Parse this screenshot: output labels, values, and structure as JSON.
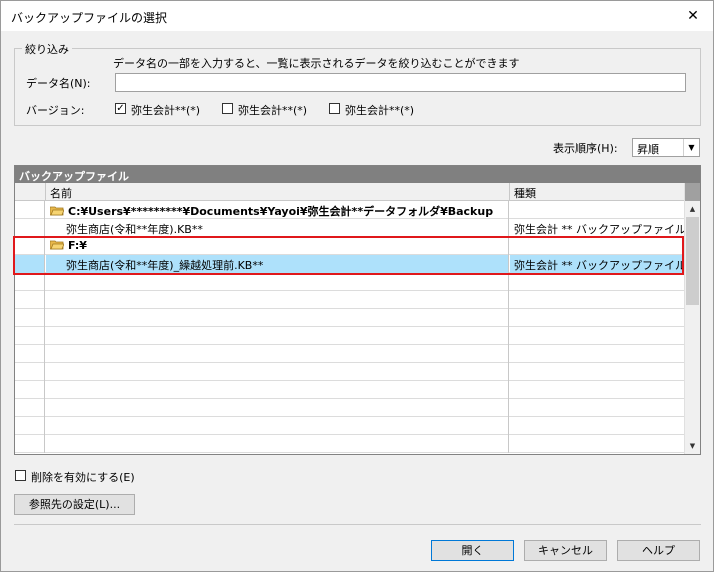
{
  "window": {
    "title": "バックアップファイルの選択",
    "close_label": "✕"
  },
  "filter": {
    "group_label": "絞り込み",
    "hint": "データ名の一部を入力すると、一覧に表示されるデータを絞り込むことができます",
    "dataname_label": "データ名(N):",
    "dataname_value": "",
    "version_label": "バージョン:",
    "versions": [
      {
        "label": "弥生会計**(*)",
        "checked": true
      },
      {
        "label": "弥生会計**(*)",
        "checked": false
      },
      {
        "label": "弥生会計**(*)",
        "checked": false
      }
    ]
  },
  "sort": {
    "label": "表示順序(H):",
    "value": "昇順"
  },
  "grid": {
    "caption": "バックアップファイル",
    "columns": [
      "名前",
      "種類"
    ],
    "rows": [
      {
        "type": "folder",
        "name": "C:¥Users¥*********¥Documents¥Yayoi¥弥生会計**データフォルダ¥Backup",
        "kind": ""
      },
      {
        "type": "file",
        "name": "弥生商店(令和**年度).KB**",
        "kind": "弥生会計 ** バックアップファイル"
      },
      {
        "type": "folder",
        "name": "F:¥",
        "kind": ""
      },
      {
        "type": "file",
        "name": "弥生商店(令和**年度)_繰越処理前.KB**",
        "kind": "弥生会計 ** バックアップファイル",
        "selected": true
      }
    ]
  },
  "delete_option": {
    "label": "削除を有効にする(E)",
    "checked": false
  },
  "buttons": {
    "browse": "参照先の設定(L)...",
    "open": "開く",
    "cancel": "キャンセル",
    "help": "ヘルプ"
  },
  "colors": {
    "highlight": "#e0181b",
    "selection": "#aee1fb",
    "caption": "#808080"
  }
}
